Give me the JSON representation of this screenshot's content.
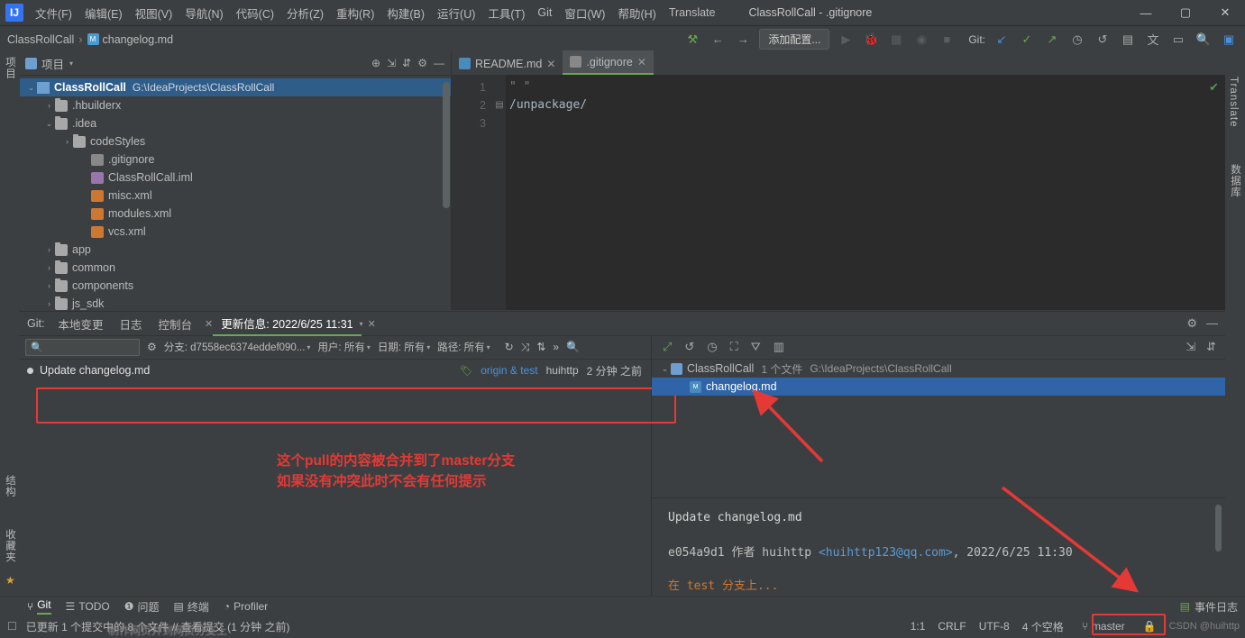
{
  "titlebar": {
    "logo": "IJ",
    "menu": [
      "文件(F)",
      "编辑(E)",
      "视图(V)",
      "导航(N)",
      "代码(C)",
      "分析(Z)",
      "重构(R)",
      "构建(B)",
      "运行(U)",
      "工具(T)",
      "Git",
      "窗口(W)",
      "帮助(H)",
      "Translate"
    ],
    "title": "ClassRollCall - .gitignore",
    "minimize": "—",
    "maximize": "▢",
    "close": "✕"
  },
  "navbar": {
    "project": "ClassRollCall",
    "separator": "›",
    "file": "changelog.md",
    "run_config": "添加配置...",
    "git_label": "Git:",
    "icons": [
      "hammer-icon",
      "back-arrow-icon",
      "forward-arrow-icon",
      "run-icon",
      "debug-icon",
      "coverage-icon",
      "profiler-icon",
      "stop-icon",
      "git-update-icon",
      "git-commit-icon",
      "git-push-icon",
      "history-icon",
      "rollback-icon",
      "db-icon",
      "translate-icon",
      "layout-icon",
      "search-icon",
      "notify-icon"
    ]
  },
  "left_strip": {
    "labels": [
      "项目",
      "结构",
      "收藏夹"
    ]
  },
  "right_strip": {
    "labels": [
      "Translate",
      "数据库"
    ]
  },
  "project_panel": {
    "title": "项目",
    "title_caret": "▾",
    "toolbar_icons": [
      "locate-icon",
      "collapse-icon",
      "expand-icon",
      "settings-icon",
      "hide-icon"
    ],
    "root": {
      "label": "ClassRollCall",
      "path": "G:\\IdeaProjects\\ClassRollCall"
    },
    "items": [
      {
        "label": ".hbuilderx",
        "indent": 2,
        "arrow": "›",
        "type": "folder"
      },
      {
        "label": ".idea",
        "indent": 2,
        "arrow": "⌄",
        "type": "folder"
      },
      {
        "label": "codeStyles",
        "indent": 3,
        "arrow": "›",
        "type": "folder"
      },
      {
        "label": ".gitignore",
        "indent": 4,
        "arrow": "",
        "type": "git"
      },
      {
        "label": "ClassRollCall.iml",
        "indent": 4,
        "arrow": "",
        "type": "iml"
      },
      {
        "label": "misc.xml",
        "indent": 4,
        "arrow": "",
        "type": "xml"
      },
      {
        "label": "modules.xml",
        "indent": 4,
        "arrow": "",
        "type": "xml"
      },
      {
        "label": "vcs.xml",
        "indent": 4,
        "arrow": "",
        "type": "xml"
      },
      {
        "label": "app",
        "indent": 2,
        "arrow": "›",
        "type": "folder"
      },
      {
        "label": "common",
        "indent": 2,
        "arrow": "›",
        "type": "folder"
      },
      {
        "label": "components",
        "indent": 2,
        "arrow": "›",
        "type": "folder"
      },
      {
        "label": "js_sdk",
        "indent": 2,
        "arrow": "›",
        "type": "folder"
      }
    ]
  },
  "editor": {
    "tabs": [
      {
        "label": "README.md",
        "icon": "md",
        "active": false,
        "close": "✕"
      },
      {
        "label": ".gitignore",
        "icon": "gi",
        "active": true,
        "close": "✕"
      }
    ],
    "gutter": [
      "1",
      "2",
      "3"
    ],
    "fold": [
      "",
      "▾",
      ""
    ],
    "lines": [
      {
        "text": "\" \"",
        "type": "comment"
      },
      {
        "text": "/unpackage/",
        "type": "code"
      },
      {
        "text": "",
        "type": "code"
      }
    ],
    "status_check": "✔"
  },
  "git_window": {
    "tabs": [
      "Git:",
      "本地变更",
      "日志",
      "控制台",
      "更新信息: 2022/6/25 11:31"
    ],
    "active_tab": "更新信息: 2022/6/25 11:31",
    "tab_caret": "▾",
    "tab_close": "✕",
    "right_icons": [
      "settings-icon",
      "hide-icon"
    ],
    "filter_bar": {
      "search_placeholder": "",
      "branch_filter": "分支: d7558ec6374eddef090...",
      "user_filter": "用户: 所有",
      "date_filter": "日期: 所有",
      "path_filter": "路径: 所有",
      "icons": [
        "refresh-icon",
        "collapse-icon",
        "sort-icon",
        "more-icon",
        "search-icon"
      ]
    },
    "commit": {
      "message": "Update changelog.md",
      "refs": "origin & test",
      "author": "huihttp",
      "time": "2 分钟 之前"
    },
    "annotation": "这个pull的内容被合并到了master分支\n如果没有冲突此时不会有任何提示",
    "annotation_line1": "这个pull的内容被合并到了master分支",
    "annotation_line2": "如果没有冲突此时不会有任何提示",
    "changes": {
      "toolbar_icons": [
        "expand-icon",
        "collapse-icon",
        "history-icon",
        "group-icon",
        "filter-icon",
        "layout-icon"
      ],
      "root": {
        "label": "ClassRollCall",
        "count": "1 个文件",
        "path": "G:\\IdeaProjects\\ClassRollCall"
      },
      "file": "changelog.md"
    },
    "detail": {
      "title": "Update changelog.md",
      "hash": "e054a9d1",
      "author_label": "作者",
      "author": "huihttp",
      "email": "<huihttp123@qq.com>",
      "date": ", 2022/6/25 11:30",
      "next_line": "在 test 分支上..."
    },
    "right_panel_icons": [
      "toolbar-right-icons"
    ]
  },
  "bottom_bar": {
    "items": [
      {
        "label": "Git",
        "icon": "git-icon",
        "active": true
      },
      {
        "label": "TODO",
        "icon": "todo-icon",
        "active": false
      },
      {
        "label": "问题",
        "icon": "problems-icon",
        "active": false
      },
      {
        "label": "终端",
        "icon": "terminal-icon",
        "active": false
      },
      {
        "label": "Profiler",
        "icon": "profiler-icon",
        "active": false
      }
    ],
    "right": {
      "label": "事件日志",
      "icon": "event-log-icon"
    }
  },
  "status_bar": {
    "left_icon": "checkbox-icon",
    "message": "已更新 1 个提交中的 8 个文件 // 查看提交 (1 分钟 之前)",
    "caret": "1:1",
    "line_sep": "CRLF",
    "encoding": "UTF-8",
    "indent": "4 个空格",
    "branch_icon": "branch-icon",
    "branch": "master",
    "lock_icon": "🔒",
    "watermark": "CSDN @huihttp"
  },
  "colors": {
    "accent_green": "#6aa84f",
    "selection_blue": "#2f65a8",
    "annotation_red": "#e53935",
    "bg": "#3c3f41",
    "editor_bg": "#2b2b2b"
  }
}
